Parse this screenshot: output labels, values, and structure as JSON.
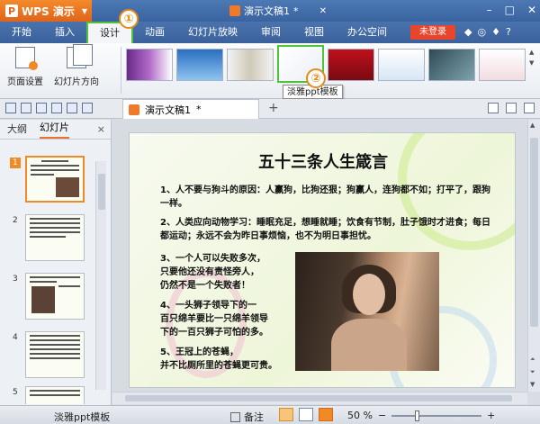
{
  "app": {
    "name": "WPS 演示",
    "logo": "P"
  },
  "window": {
    "doc_title": "演示文稿1",
    "doc_modified_mark": "*"
  },
  "menu": {
    "tabs": [
      "开始",
      "插入",
      "设计",
      "动画",
      "幻灯片放映",
      "审阅",
      "视图",
      "办公空间"
    ],
    "active": "设计",
    "login": "未登录"
  },
  "ribbon": {
    "page_setup": "页面设置",
    "slide_orientation": "幻灯片方向",
    "tooltip": "淡雅ppt模板"
  },
  "markers": {
    "m1": "①",
    "m2": "②"
  },
  "doc_tab": {
    "label": "演示文稿1",
    "mark": "*",
    "add": "+"
  },
  "side_panel": {
    "tabs": [
      "大纲",
      "幻灯片"
    ],
    "active": "幻灯片",
    "close": "×",
    "slides": [
      "1",
      "2",
      "3",
      "4",
      "5"
    ]
  },
  "slide": {
    "title": "五十三条人生箴言",
    "p1": "1、人不要与狗斗的原因：人赢狗，比狗还狠；狗赢人，连狗都不如；打平了，跟狗一样。",
    "p2": "2、人类应向动物学习：睡眠充足，想睡就睡；饮食有节制，肚子饿时才进食；每日都运动；永远不会为昨日事烦恼，也不为明日事担忧。",
    "p3a": "3、一个人可以失败多次，",
    "p3b": "只要他还没有责怪旁人，",
    "p3c": "仍然不是一个失败者！",
    "p4a": "4、一头狮子领导下的一",
    "p4b": "百只绵羊要比一只绵羊领导",
    "p4c": "下的一百只狮子可怕的多。",
    "p5a": "5、王冠上的苍蝇，",
    "p5b": "并不比厕所里的苍蝇更可贵。"
  },
  "status": {
    "template": "淡雅ppt模板",
    "notes": "备注",
    "zoom": "50 %",
    "zoom_minus": "−",
    "zoom_plus": "+"
  },
  "colors": {
    "accent_orange": "#f08a24",
    "highlight_green": "#4fc43a",
    "title_blue": "#3a64a0"
  }
}
